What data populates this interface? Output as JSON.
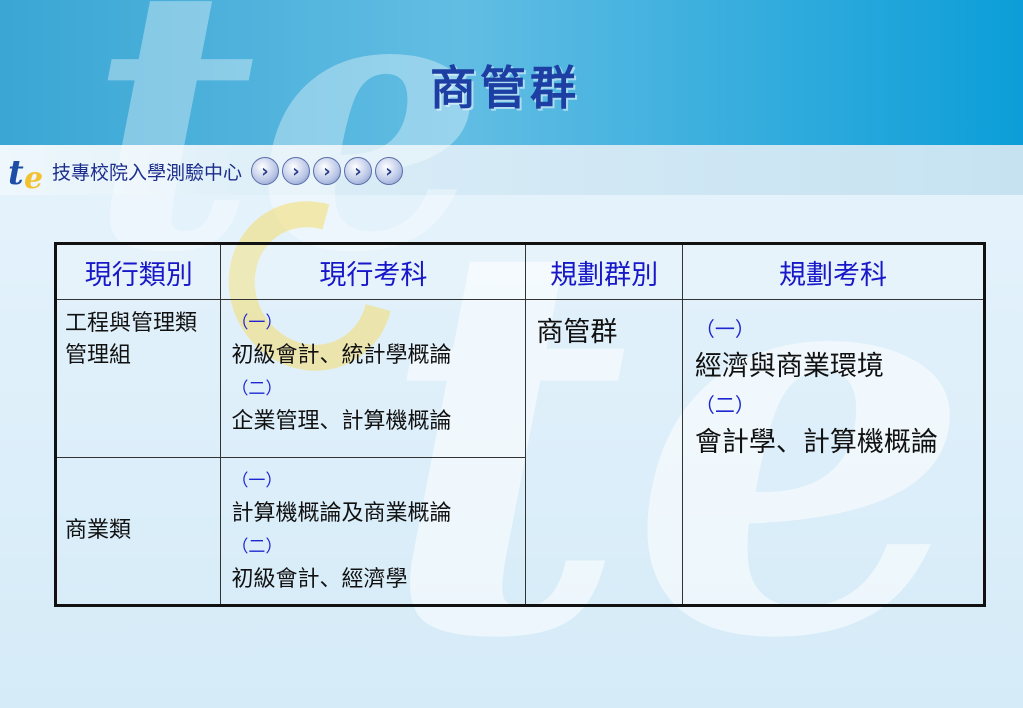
{
  "title": "商管群",
  "header": {
    "org_name": "技專校院入學測驗中心",
    "logo_letters": "tte",
    "nav_arrows": 5
  },
  "colors": {
    "title": "#1d3fa3",
    "header_text": "#1818c8",
    "number_marker": "#1e26d0",
    "band": "#3aa6d4"
  },
  "table": {
    "headers": [
      "現行類別",
      "現行考科",
      "規劃群別",
      "規劃考科"
    ],
    "rows": [
      {
        "category": "工程與管理類管理組",
        "subjects": [
          {
            "num": "（一）",
            "text": "初級會計、統計學概論"
          },
          {
            "num": "（二）",
            "text": "企業管理、計算機概論"
          }
        ]
      },
      {
        "category": "商業類",
        "subjects": [
          {
            "num": "（一）",
            "text": "計算機概論及商業概論"
          },
          {
            "num": "（二）",
            "text": "初級會計、經濟學"
          }
        ]
      }
    ],
    "planned_group": "商管群",
    "planned_subjects": [
      {
        "num": "（一）",
        "text": "經濟與商業環境"
      },
      {
        "num": "（二）",
        "text": "會計學、計算機概論"
      }
    ]
  }
}
